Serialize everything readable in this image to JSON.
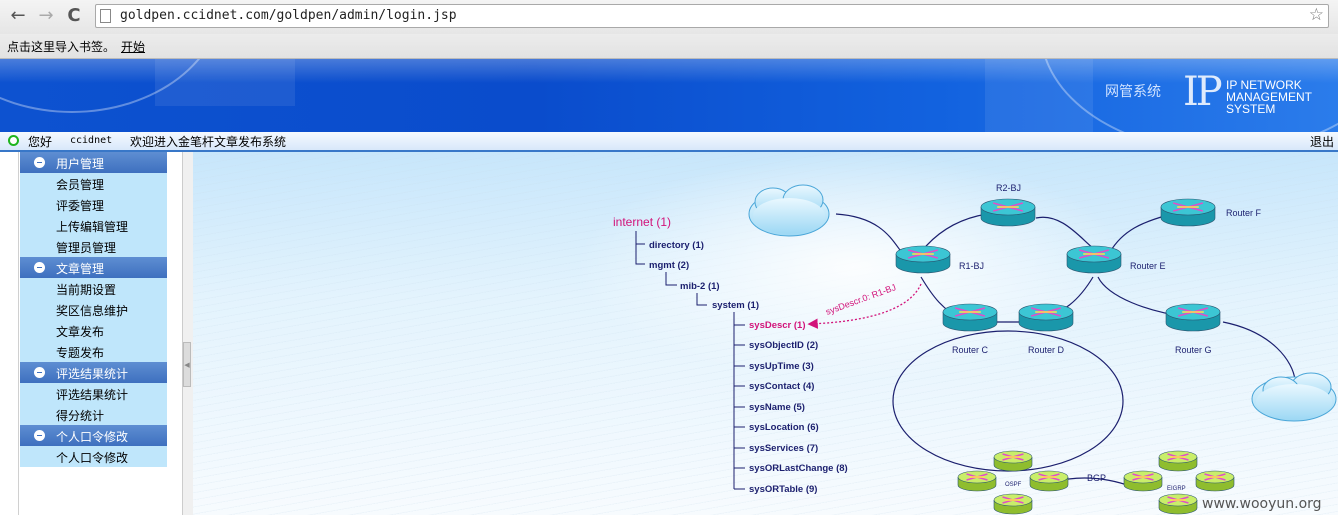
{
  "browser": {
    "url": "goldpen.ccidnet.com/goldpen/admin/login.jsp",
    "back_label": "←",
    "forward_label": "→",
    "reload_label": "C",
    "star_label": "☆"
  },
  "bookmarks_bar": {
    "hint": "点击这里导入书签。",
    "link": "开始"
  },
  "banner": {
    "label": "网管系统",
    "logo_ip": "IP",
    "logo_lines": [
      "IP NETWORK",
      "MANAGEMENT",
      "SYSTEM"
    ]
  },
  "status_bar": {
    "greeting": "您好",
    "user": "ccidnet",
    "welcome": "欢迎进入金笔杆文章发布系统",
    "logout": "退出"
  },
  "sidebar": {
    "groups": [
      {
        "title": "用户管理",
        "items": [
          "会员管理",
          "评委管理",
          "上传编辑管理",
          "管理员管理"
        ]
      },
      {
        "title": "文章管理",
        "items": [
          "当前期设置",
          "奖区信息维护",
          "文章发布",
          "专题发布"
        ]
      },
      {
        "title": "评选结果统计",
        "items": [
          "评选结果统计",
          "得分统计"
        ]
      },
      {
        "title": "个人口令修改",
        "items": [
          "个人口令修改"
        ]
      }
    ]
  },
  "diagram": {
    "tree_root": "internet (1)",
    "tree": [
      "directory (1)",
      "mgmt (2)",
      "mib-2 (1)",
      "system (1)"
    ],
    "leaves": [
      "sysDescr (1)",
      "sysObjectID (2)",
      "sysUpTime (3)",
      "sysContact (4)",
      "sysName (5)",
      "sysLocation (6)",
      "sysServices (7)",
      "sysORLastChange (8)",
      "sysORTable (9)"
    ],
    "arrow_label": "sysDescr.0: R1-BJ",
    "routers": [
      "R2-BJ",
      "Router F",
      "R1-BJ",
      "Router E",
      "Router C",
      "Router D",
      "Router G"
    ],
    "bottom": [
      "OSPF",
      "BGP",
      "EIGRP"
    ],
    "colors": {
      "highlight": "#d2137a",
      "router": "#3cc6d4",
      "router_green": "#c9ee6a",
      "link": "#1b1f6e"
    }
  },
  "watermark": "www.wooyun.org"
}
